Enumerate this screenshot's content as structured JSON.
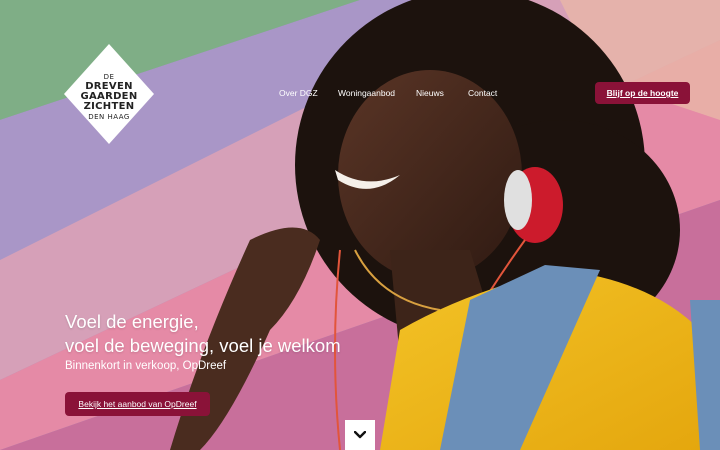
{
  "brand": {
    "logo_line1": "DE",
    "logo_line2": "DREVEN",
    "logo_line3": "GAARDEN",
    "logo_line4": "ZICHTEN",
    "logo_line5": "DEN HAAG"
  },
  "nav": {
    "items": [
      {
        "label": "Over DGZ"
      },
      {
        "label": "Woningaanbod"
      },
      {
        "label": "Nieuws"
      },
      {
        "label": "Contact"
      }
    ],
    "cta_label": "Blijf op de hoogte"
  },
  "hero": {
    "headline_line1": "Voel de energie,",
    "headline_line2": "voel de beweging, voel je welkom",
    "subline": "Binnenkort in verkoop, OpDreef",
    "cta_label": "Bekijk het aanbod van OpDreef",
    "scroll_icon": "chevron-down-icon"
  },
  "colors": {
    "accent": "#8a1238",
    "text_on_image": "#ffffff"
  }
}
